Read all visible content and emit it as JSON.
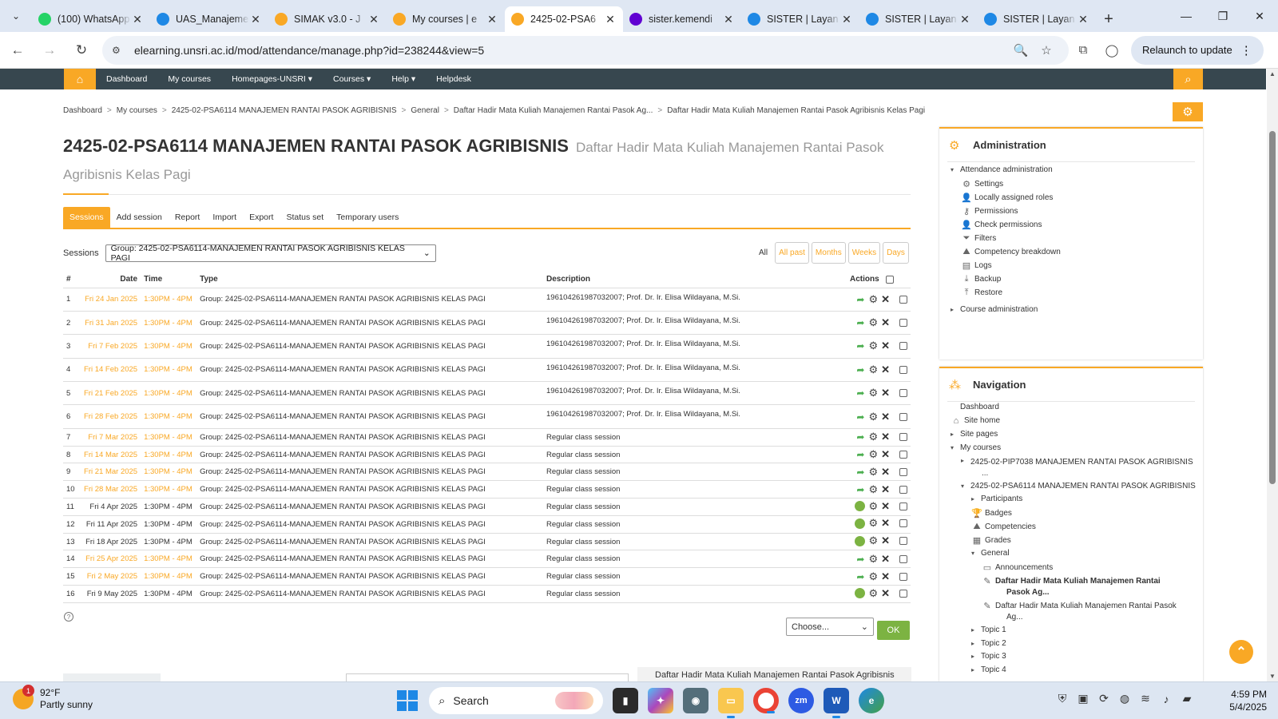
{
  "browser": {
    "tabs": [
      {
        "title": "(100) WhatsApp",
        "icon": "whatsapp-icon",
        "color": "#25d366",
        "glyph": "99+"
      },
      {
        "title": "UAS_Manajemen",
        "icon": "google-drive-icon",
        "color": "#1e88e5",
        "glyph": "▲"
      },
      {
        "title": "SIMAK v3.0 - J",
        "icon": "unsri-icon",
        "color": "#f9a825",
        "glyph": "●"
      },
      {
        "title": "My courses | e",
        "icon": "unsri-icon",
        "color": "#f9a825",
        "glyph": "●"
      },
      {
        "title": "2425-02-PSA6",
        "icon": "unsri-icon",
        "color": "#f9a825",
        "glyph": "●"
      },
      {
        "title": "sister.kemendi",
        "icon": "yahoo-icon",
        "color": "#6001d2",
        "glyph": "y"
      },
      {
        "title": "SISTER | Layan",
        "icon": "sister-icon",
        "color": "#1e88e5",
        "glyph": "S"
      },
      {
        "title": "SISTER | Layan",
        "icon": "sister-icon",
        "color": "#1e88e5",
        "glyph": "S"
      },
      {
        "title": "SISTER | Layan",
        "icon": "sister-icon",
        "color": "#1e88e5",
        "glyph": "S"
      }
    ],
    "active_tab": 4,
    "url": "elearning.unsri.ac.id/mod/attendance/manage.php?id=238244&view=5",
    "relaunch_label": "Relaunch to update"
  },
  "navbar": {
    "items": [
      "Dashboard",
      "My courses",
      "Homepages-UNSRI ▾",
      "Courses ▾",
      "Help ▾",
      "Helpdesk"
    ]
  },
  "breadcrumb": [
    "Dashboard",
    "My courses",
    "2425-02-PSA6114 MANAJEMEN RANTAI PASOK AGRIBISNIS",
    "General",
    "Daftar Hadir Mata Kuliah Manajemen Rantai Pasok Ag...",
    "Daftar Hadir Mata Kuliah Manajemen Rantai Pasok Agribisnis Kelas Pagi"
  ],
  "page": {
    "course_title": "2425-02-PSA6114 MANAJEMEN RANTAI PASOK AGRIBISNIS",
    "subtitle": "Daftar Hadir Mata Kuliah Manajemen Rantai Pasok Agribisnis Kelas Pagi"
  },
  "attendance_tabs": [
    "Sessions",
    "Add session",
    "Report",
    "Import",
    "Export",
    "Status set",
    "Temporary users"
  ],
  "sessions_filter": {
    "label": "Sessions",
    "selected": "Group: 2425-02-PSA6114-MANAJEMEN RANTAI PASOK AGRIBISNIS KELAS PAGI",
    "view_all": "All",
    "view_buttons": [
      "All past",
      "Months",
      "Weeks",
      "Days"
    ]
  },
  "table": {
    "headers": {
      "num": "#",
      "date": "Date",
      "time": "Time",
      "type": "Type",
      "description": "Description",
      "actions": "Actions"
    },
    "rows": [
      {
        "num": "1",
        "date": "Fri 24 Jan 2025",
        "time": "1:30PM - 4PM",
        "type": "Group: 2425-02-PSA6114-MANAJEMEN RANTAI PASOK AGRIBISNIS KELAS PAGI",
        "description": "196104261987032007; Prof. Dr. Ir. Elisa Wildayana, M.Si.",
        "past": true,
        "tall": true,
        "status": "go"
      },
      {
        "num": "2",
        "date": "Fri 31 Jan 2025",
        "time": "1:30PM - 4PM",
        "type": "Group: 2425-02-PSA6114-MANAJEMEN RANTAI PASOK AGRIBISNIS KELAS PAGI",
        "description": "196104261987032007; Prof. Dr. Ir. Elisa Wildayana, M.Si.",
        "past": true,
        "tall": true,
        "status": "go"
      },
      {
        "num": "3",
        "date": "Fri 7 Feb 2025",
        "time": "1:30PM - 4PM",
        "type": "Group: 2425-02-PSA6114-MANAJEMEN RANTAI PASOK AGRIBISNIS KELAS PAGI",
        "description": "196104261987032007; Prof. Dr. Ir. Elisa Wildayana, M.Si.",
        "past": true,
        "tall": true,
        "status": "go"
      },
      {
        "num": "4",
        "date": "Fri 14 Feb 2025",
        "time": "1:30PM - 4PM",
        "type": "Group: 2425-02-PSA6114-MANAJEMEN RANTAI PASOK AGRIBISNIS KELAS PAGI",
        "description": "196104261987032007; Prof. Dr. Ir. Elisa Wildayana, M.Si.",
        "past": true,
        "tall": true,
        "status": "go"
      },
      {
        "num": "5",
        "date": "Fri 21 Feb 2025",
        "time": "1:30PM - 4PM",
        "type": "Group: 2425-02-PSA6114-MANAJEMEN RANTAI PASOK AGRIBISNIS KELAS PAGI",
        "description": "196104261987032007; Prof. Dr. Ir. Elisa Wildayana, M.Si.",
        "past": true,
        "tall": true,
        "status": "go"
      },
      {
        "num": "6",
        "date": "Fri 28 Feb 2025",
        "time": "1:30PM - 4PM",
        "type": "Group: 2425-02-PSA6114-MANAJEMEN RANTAI PASOK AGRIBISNIS KELAS PAGI",
        "description": "196104261987032007; Prof. Dr. Ir. Elisa Wildayana, M.Si.",
        "past": true,
        "tall": true,
        "status": "go"
      },
      {
        "num": "7",
        "date": "Fri 7 Mar 2025",
        "time": "1:30PM - 4PM",
        "type": "Group: 2425-02-PSA6114-MANAJEMEN RANTAI PASOK AGRIBISNIS KELAS PAGI",
        "description": "Regular class session",
        "past": true,
        "tall": false,
        "status": "go"
      },
      {
        "num": "8",
        "date": "Fri 14 Mar 2025",
        "time": "1:30PM - 4PM",
        "type": "Group: 2425-02-PSA6114-MANAJEMEN RANTAI PASOK AGRIBISNIS KELAS PAGI",
        "description": "Regular class session",
        "past": true,
        "tall": false,
        "status": "go"
      },
      {
        "num": "9",
        "date": "Fri 21 Mar 2025",
        "time": "1:30PM - 4PM",
        "type": "Group: 2425-02-PSA6114-MANAJEMEN RANTAI PASOK AGRIBISNIS KELAS PAGI",
        "description": "Regular class session",
        "past": true,
        "tall": false,
        "status": "go"
      },
      {
        "num": "10",
        "date": "Fri 28 Mar 2025",
        "time": "1:30PM - 4PM",
        "type": "Group: 2425-02-PSA6114-MANAJEMEN RANTAI PASOK AGRIBISNIS KELAS PAGI",
        "description": "Regular class session",
        "past": true,
        "tall": false,
        "status": "go"
      },
      {
        "num": "11",
        "date": "Fri 4 Apr 2025",
        "time": "1:30PM - 4PM",
        "type": "Group: 2425-02-PSA6114-MANAJEMEN RANTAI PASOK AGRIBISNIS KELAS PAGI",
        "description": "Regular class session",
        "past": false,
        "tall": false,
        "status": "taken"
      },
      {
        "num": "12",
        "date": "Fri 11 Apr 2025",
        "time": "1:30PM - 4PM",
        "type": "Group: 2425-02-PSA6114-MANAJEMEN RANTAI PASOK AGRIBISNIS KELAS PAGI",
        "description": "Regular class session",
        "past": false,
        "tall": false,
        "status": "taken"
      },
      {
        "num": "13",
        "date": "Fri 18 Apr 2025",
        "time": "1:30PM - 4PM",
        "type": "Group: 2425-02-PSA6114-MANAJEMEN RANTAI PASOK AGRIBISNIS KELAS PAGI",
        "description": "Regular class session",
        "past": false,
        "tall": false,
        "status": "taken"
      },
      {
        "num": "14",
        "date": "Fri 25 Apr 2025",
        "time": "1:30PM - 4PM",
        "type": "Group: 2425-02-PSA6114-MANAJEMEN RANTAI PASOK AGRIBISNIS KELAS PAGI",
        "description": "Regular class session",
        "past": true,
        "tall": false,
        "status": "go"
      },
      {
        "num": "15",
        "date": "Fri 2 May 2025",
        "time": "1:30PM - 4PM",
        "type": "Group: 2425-02-PSA6114-MANAJEMEN RANTAI PASOK AGRIBISNIS KELAS PAGI",
        "description": "Regular class session",
        "past": true,
        "tall": false,
        "status": "go"
      },
      {
        "num": "16",
        "date": "Fri 9 May 2025",
        "time": "1:30PM - 4PM",
        "type": "Group: 2425-02-PSA6114-MANAJEMEN RANTAI PASOK AGRIBISNIS KELAS PAGI",
        "description": "Regular class session",
        "past": false,
        "tall": false,
        "status": "taken"
      }
    ],
    "bulk_select": "Choose...",
    "ok_label": "OK"
  },
  "bottom_preview": "Daftar Hadir Mata Kuliah Manajemen Rantai Pasok Agribisnis",
  "admin_block": {
    "title": "Administration",
    "items": [
      {
        "label": "Attendance administration",
        "caret": "▾",
        "icon": "",
        "indent": 0
      },
      {
        "label": "Settings",
        "caret": "",
        "icon": "gear-icon",
        "indent": 1
      },
      {
        "label": "Locally assigned roles",
        "caret": "",
        "icon": "user-icon",
        "indent": 1
      },
      {
        "label": "Permissions",
        "caret": "",
        "icon": "key-icon",
        "indent": 1
      },
      {
        "label": "Check permissions",
        "caret": "",
        "icon": "user-check-icon",
        "indent": 1
      },
      {
        "label": "Filters",
        "caret": "",
        "icon": "filter-icon",
        "indent": 1
      },
      {
        "label": "Competency breakdown",
        "caret": "",
        "icon": "competency-icon",
        "indent": 1
      },
      {
        "label": "Logs",
        "caret": "",
        "icon": "logs-icon",
        "indent": 1
      },
      {
        "label": "Backup",
        "caret": "",
        "icon": "backup-icon",
        "indent": 1
      },
      {
        "label": "Restore",
        "caret": "",
        "icon": "restore-icon",
        "indent": 1
      },
      {
        "label": "Course administration",
        "caret": "▸",
        "icon": "",
        "indent": 0
      }
    ]
  },
  "nav_block": {
    "title": "Navigation",
    "items": [
      {
        "label": "Dashboard",
        "caret": "",
        "icon": "",
        "indent": 0,
        "bold": false
      },
      {
        "label": "Site home",
        "caret": "",
        "icon": "home-icon",
        "indent": 0,
        "bold": false
      },
      {
        "label": "Site pages",
        "caret": "▸",
        "icon": "",
        "indent": 0,
        "bold": false
      },
      {
        "label": "My courses",
        "caret": "▾",
        "icon": "",
        "indent": 0,
        "bold": false
      },
      {
        "label": "2425-02-PIP7038 MANAJEMEN RANTAI PASOK AGRIBISNIS",
        "label2": "...",
        "caret": "▸",
        "icon": "",
        "indent": 1,
        "bold": false
      },
      {
        "label": "2425-02-PSA6114 MANAJEMEN RANTAI PASOK AGRIBISNIS",
        "caret": "▾",
        "icon": "",
        "indent": 1,
        "bold": false
      },
      {
        "label": "Participants",
        "caret": "▸",
        "icon": "",
        "indent": 2,
        "bold": false
      },
      {
        "label": "Badges",
        "caret": "",
        "icon": "trophy-icon",
        "indent": 2,
        "bold": false
      },
      {
        "label": "Competencies",
        "caret": "",
        "icon": "competency-icon",
        "indent": 2,
        "bold": false
      },
      {
        "label": "Grades",
        "caret": "",
        "icon": "grades-icon",
        "indent": 2,
        "bold": false
      },
      {
        "label": "General",
        "caret": "▾",
        "icon": "",
        "indent": 2,
        "bold": false
      },
      {
        "label": "Announcements",
        "caret": "",
        "icon": "forum-icon",
        "indent": 3,
        "bold": false
      },
      {
        "label": "Daftar Hadir Mata Kuliah Manajemen Rantai",
        "label2": "Pasok Ag...",
        "caret": "",
        "icon": "attendance-icon",
        "indent": 3,
        "bold": true
      },
      {
        "label": "Daftar Hadir Mata Kuliah Manajemen Rantai Pasok",
        "label2": "Ag...",
        "caret": "",
        "icon": "attendance-icon",
        "indent": 3,
        "bold": false
      },
      {
        "label": "Topic 1",
        "caret": "▸",
        "icon": "",
        "indent": 2,
        "bold": false
      },
      {
        "label": "Topic 2",
        "caret": "▸",
        "icon": "",
        "indent": 2,
        "bold": false
      },
      {
        "label": "Topic 3",
        "caret": "▸",
        "icon": "",
        "indent": 2,
        "bold": false
      },
      {
        "label": "Topic 4",
        "caret": "▸",
        "icon": "",
        "indent": 2,
        "bold": false
      }
    ]
  },
  "taskbar": {
    "weather_temp": "92°F",
    "weather_desc": "Partly sunny",
    "weather_badge": "1",
    "search_label": "Search",
    "time": "4:59 PM",
    "date": "5/4/2025"
  },
  "colors": {
    "accent": "#f9a825",
    "navbar": "#37474f",
    "ok": "#7cb342"
  }
}
